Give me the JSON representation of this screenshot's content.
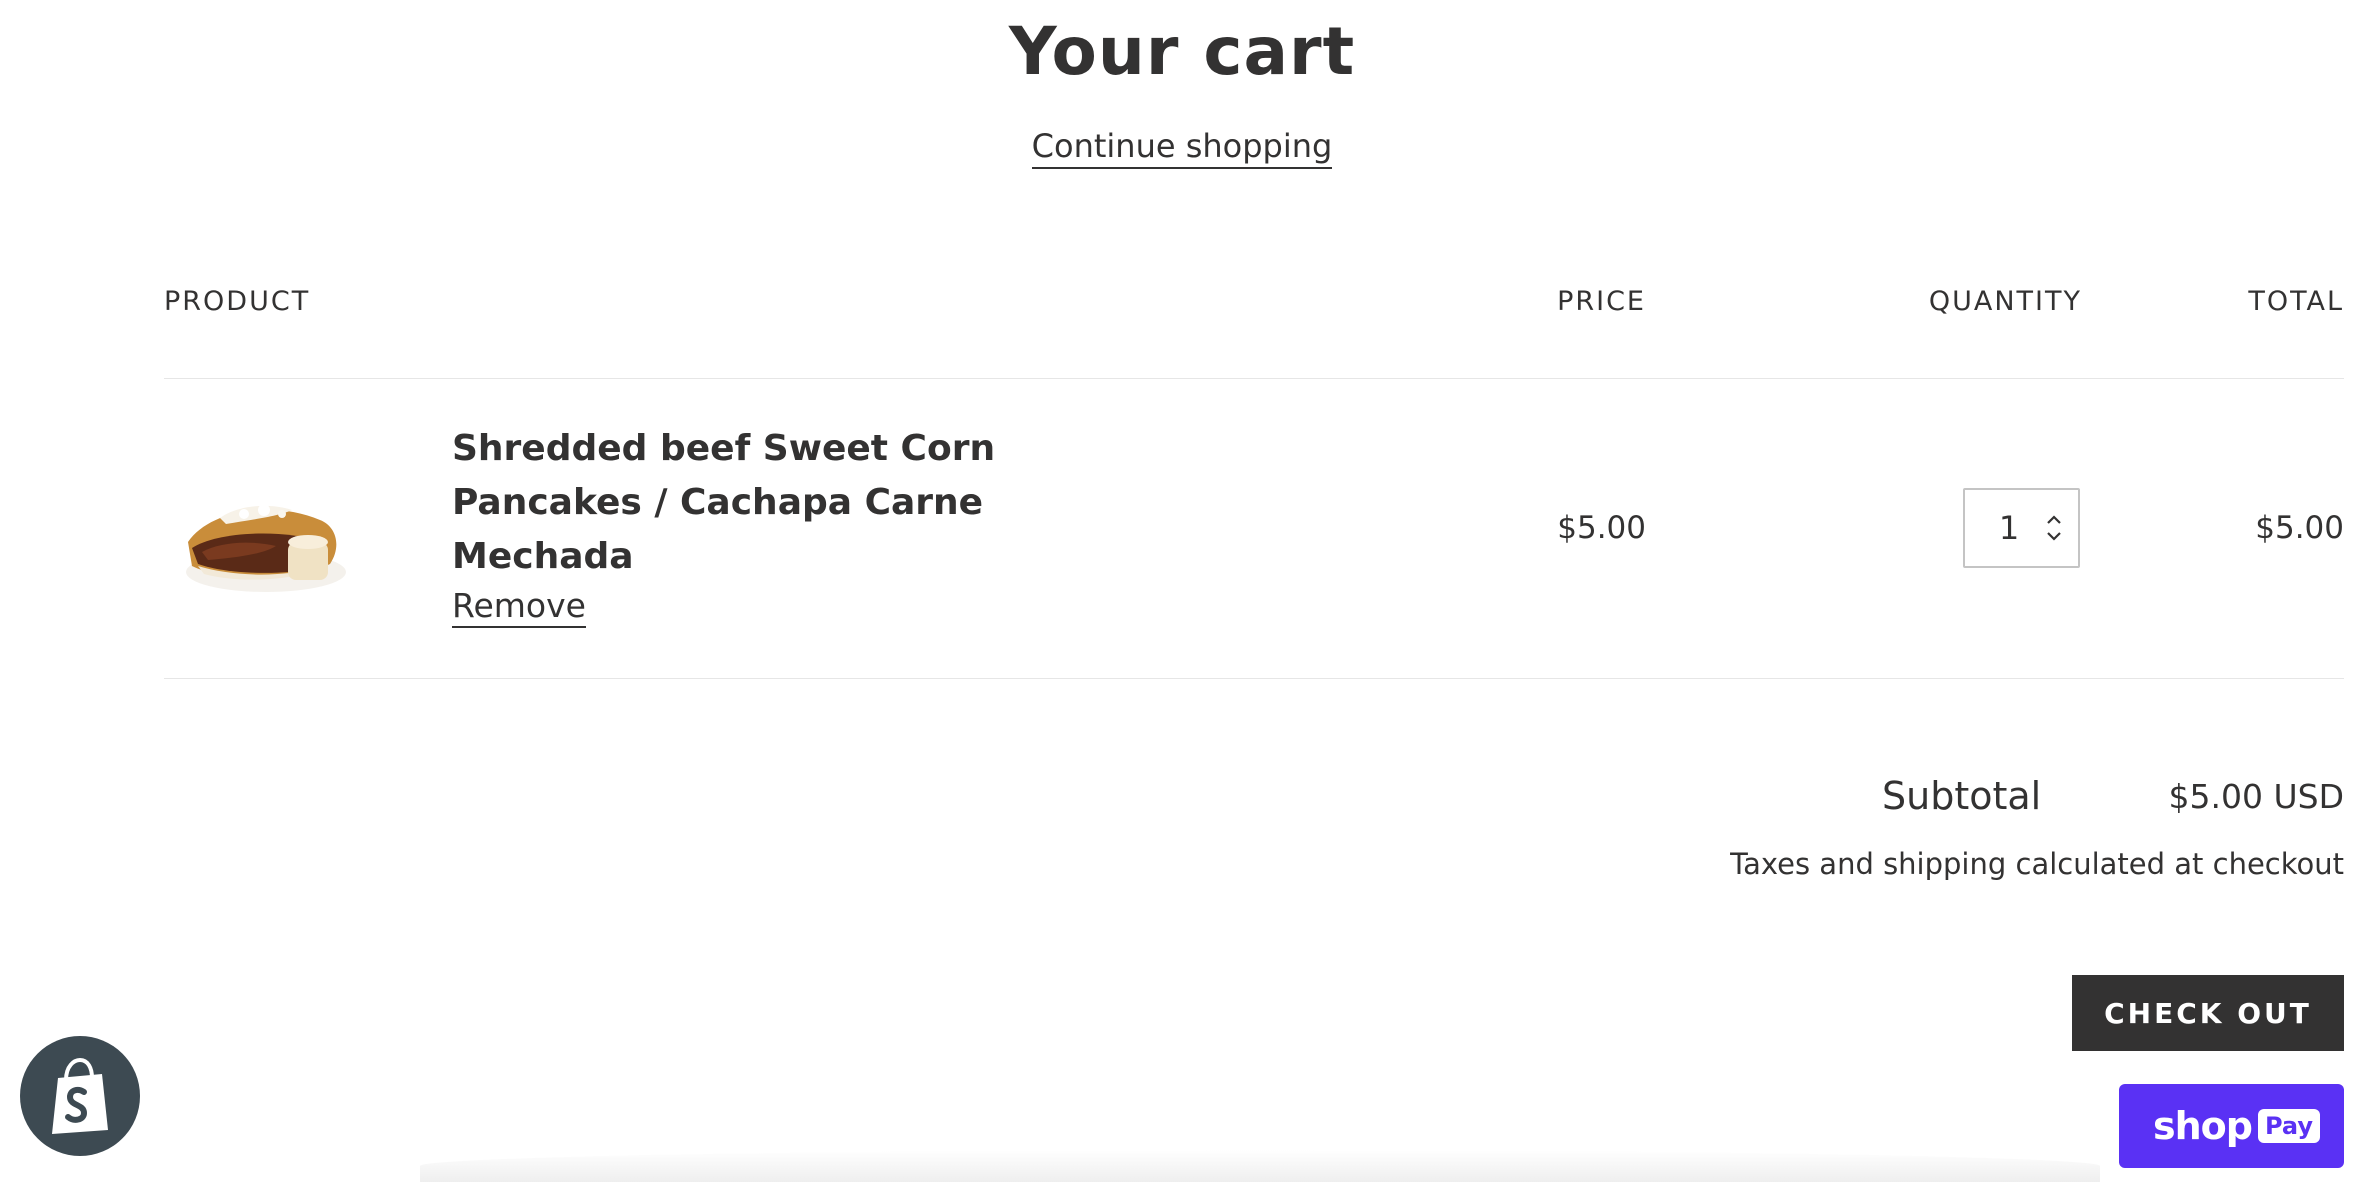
{
  "page": {
    "title": "Your cart",
    "continue_label": "Continue shopping"
  },
  "table": {
    "headers": {
      "product": "PRODUCT",
      "price": "PRICE",
      "quantity": "QUANTITY",
      "total": "TOTAL"
    }
  },
  "item": {
    "name": "Shredded beef Sweet Corn Pancakes / Cachapa Carne Mechada",
    "remove_label": "Remove",
    "price": "$5.00",
    "quantity": "1",
    "total": "$5.00"
  },
  "summary": {
    "subtotal_label": "Subtotal",
    "subtotal_value": "$5.00 USD",
    "tax_note": "Taxes and shipping calculated at checkout",
    "checkout_label": "CHECK OUT"
  },
  "shop_pay": {
    "shop_text": "shop",
    "pay_text": "Pay",
    "brand_color": "#5a31f4"
  },
  "colors": {
    "text": "#333232",
    "checkout_bg": "#333232",
    "shopify_badge_bg": "#3d4a52"
  },
  "icons": {
    "shopify_badge": "shopify-bag-icon",
    "quantity_up": "chevron-up-icon",
    "quantity_down": "chevron-down-icon"
  }
}
